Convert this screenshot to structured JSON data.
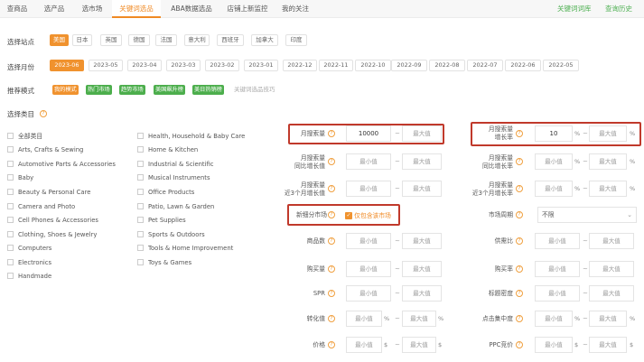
{
  "nav": {
    "tabs": [
      "查商品",
      "选产品",
      "选市场",
      "关键词选品",
      "ABA数据选品",
      "店铺上新监控",
      "我的关注"
    ],
    "active_index": 3,
    "right_links": [
      "关键词词库",
      "查询历史"
    ]
  },
  "site": {
    "label": "选择站点",
    "options": [
      "美国",
      "日本",
      "英国",
      "德国",
      "法国",
      "意大利",
      "西班牙",
      "加拿大",
      "印度"
    ],
    "selected": "美国"
  },
  "month": {
    "label": "选择月份",
    "options": [
      "2023-06",
      "2023-05",
      "2023-04",
      "2023-03",
      "2023-02",
      "2023-01",
      "2022-12",
      "2022-11",
      "2022-10",
      "2022-09",
      "2022-08",
      "2022-07",
      "2022-06",
      "2022-05"
    ],
    "selected": "2023-06"
  },
  "mode": {
    "label": "推荐模式",
    "tags": [
      "我的模式",
      "热门市场",
      "趋势市场",
      "美国飙升榜",
      "美日热销榜"
    ],
    "tip": "关键词选品技巧"
  },
  "category": {
    "label": "选择类目",
    "col1": [
      "全部类目",
      "Arts, Crafts & Sewing",
      "Automotive Parts & Accessories",
      "Baby",
      "Beauty & Personal Care",
      "Camera and Photo",
      "Cell Phones & Accessories",
      "Clothing, Shoes & Jewelry",
      "Computers",
      "Electronics",
      "Handmade"
    ],
    "col2": [
      "Health, Household & Baby Care",
      "Home & Kitchen",
      "Industrial & Scientific",
      "Musical Instruments",
      "Office Products",
      "Patio, Lawn & Garden",
      "Pet Supplies",
      "Sports & Outdoors",
      "Tools & Home Improvement",
      "Toys & Games"
    ]
  },
  "filters": {
    "min_ph": "最小值",
    "max_ph": "最大值",
    "monthly_search": {
      "label": "月搜索量",
      "min": "10000",
      "max": "最大值"
    },
    "search_growth": {
      "label1": "月搜索量",
      "label2": "增长率",
      "min": "10",
      "max": "最大值",
      "unit": "%"
    },
    "yoy": {
      "label1": "月搜索量",
      "label2": "同比增长值"
    },
    "yoy_rate": {
      "label1": "月搜索量",
      "label2": "同比增长率"
    },
    "avg3": {
      "label1": "月搜索量",
      "label2": "近3个月增长值"
    },
    "avg3_rate": {
      "label1": "月搜索量",
      "label2": "近3个月增长率"
    },
    "new_market": {
      "label": "新细分市场",
      "checkbox": "仅包含该市场"
    },
    "market_cycle": {
      "label": "市场周期",
      "value": "不限"
    },
    "product_count": {
      "label": "商品数"
    },
    "supply_ratio": {
      "label": "供需比"
    },
    "purchase_count": {
      "label": "购买量"
    },
    "purchase_rate": {
      "label": "购买率"
    },
    "spr": {
      "label": "SPR"
    },
    "title_density": {
      "label": "标题密度"
    },
    "click_share": {
      "label": "点击集中度"
    },
    "conversion_share": {
      "label": "转化值"
    },
    "price": {
      "label": "价格",
      "unit": "$"
    },
    "ppc": {
      "label": "PPC竞价",
      "unit": "$"
    },
    "pct": "%"
  }
}
